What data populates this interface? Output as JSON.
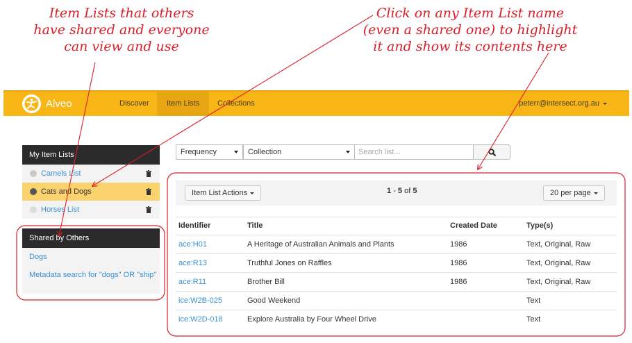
{
  "annotations": {
    "left_lines": [
      "Item Lists that others",
      "have shared and everyone",
      "can view and use"
    ],
    "right_lines": [
      "Click on any Item List name",
      "(even a shared one) to highlight",
      "it and show its contents here"
    ]
  },
  "navbar": {
    "brand": "Alveo",
    "items": [
      "Discover",
      "Item Lists",
      "Collections"
    ],
    "active": "Item Lists",
    "user": "peterr@intersect.org.au"
  },
  "sidebar": {
    "my_lists_title": "My Item Lists",
    "my_lists": [
      {
        "name": "Camels List",
        "active": false
      },
      {
        "name": "Cats and Dogs",
        "active": true
      },
      {
        "name": "Horses List",
        "active": false
      }
    ],
    "shared_title": "Shared by Others",
    "shared": [
      "Dogs",
      "Metadata search for \"dogs\" OR \"ship\""
    ]
  },
  "search": {
    "frequency_label": "Frequency",
    "collection_label": "Collection",
    "placeholder": "Search list..."
  },
  "content": {
    "actions_label": "Item List Actions",
    "pager": {
      "start": "1",
      "end": "5",
      "of": "of",
      "total": "5",
      "sep": "-"
    },
    "per_page": "20 per page",
    "columns": [
      "Identifier",
      "Title",
      "Created Date",
      "Type(s)"
    ],
    "rows": [
      {
        "id": "ace:H01",
        "title": "A Heritage of Australian Animals and Plants",
        "date": "1986",
        "types": "Text, Original, Raw"
      },
      {
        "id": "ace:R13",
        "title": "Truthful Jones on Raffles",
        "date": "1986",
        "types": "Text, Original, Raw"
      },
      {
        "id": "ace:R11",
        "title": "Brother Bill",
        "date": "1986",
        "types": "Text, Original, Raw"
      },
      {
        "id": "ice:W2B-025",
        "title": "Good Weekend",
        "date": "",
        "types": "Text"
      },
      {
        "id": "ice:W2D-018",
        "title": "Explore Australia by Four Wheel Drive",
        "date": "",
        "types": "Text"
      }
    ]
  },
  "colors": {
    "navbar": "#f7b516",
    "link": "#3a8fd0",
    "annotation": "#d8202a",
    "active_row": "#fad26e"
  }
}
